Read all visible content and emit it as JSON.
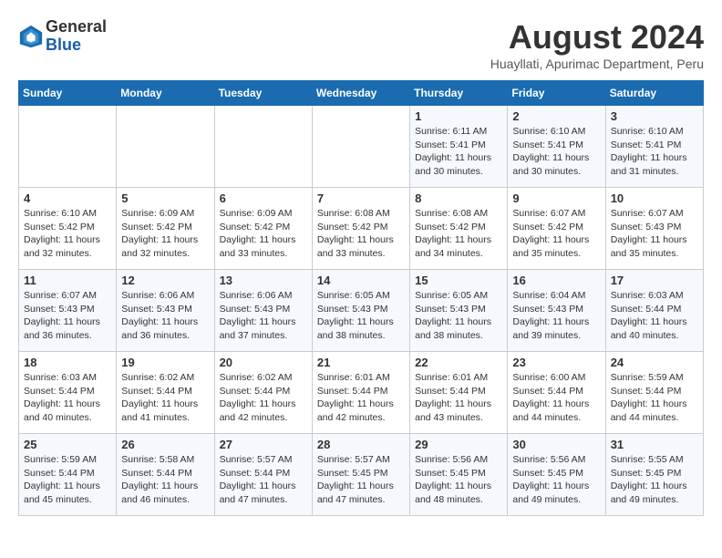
{
  "header": {
    "logo_line1": "General",
    "logo_line2": "Blue",
    "month_title": "August 2024",
    "location": "Huayllati, Apurimac Department, Peru"
  },
  "days_of_week": [
    "Sunday",
    "Monday",
    "Tuesday",
    "Wednesday",
    "Thursday",
    "Friday",
    "Saturday"
  ],
  "weeks": [
    [
      {
        "day": "",
        "info": ""
      },
      {
        "day": "",
        "info": ""
      },
      {
        "day": "",
        "info": ""
      },
      {
        "day": "",
        "info": ""
      },
      {
        "day": "1",
        "info": "Sunrise: 6:11 AM\nSunset: 5:41 PM\nDaylight: 11 hours\nand 30 minutes."
      },
      {
        "day": "2",
        "info": "Sunrise: 6:10 AM\nSunset: 5:41 PM\nDaylight: 11 hours\nand 30 minutes."
      },
      {
        "day": "3",
        "info": "Sunrise: 6:10 AM\nSunset: 5:41 PM\nDaylight: 11 hours\nand 31 minutes."
      }
    ],
    [
      {
        "day": "4",
        "info": "Sunrise: 6:10 AM\nSunset: 5:42 PM\nDaylight: 11 hours\nand 32 minutes."
      },
      {
        "day": "5",
        "info": "Sunrise: 6:09 AM\nSunset: 5:42 PM\nDaylight: 11 hours\nand 32 minutes."
      },
      {
        "day": "6",
        "info": "Sunrise: 6:09 AM\nSunset: 5:42 PM\nDaylight: 11 hours\nand 33 minutes."
      },
      {
        "day": "7",
        "info": "Sunrise: 6:08 AM\nSunset: 5:42 PM\nDaylight: 11 hours\nand 33 minutes."
      },
      {
        "day": "8",
        "info": "Sunrise: 6:08 AM\nSunset: 5:42 PM\nDaylight: 11 hours\nand 34 minutes."
      },
      {
        "day": "9",
        "info": "Sunrise: 6:07 AM\nSunset: 5:42 PM\nDaylight: 11 hours\nand 35 minutes."
      },
      {
        "day": "10",
        "info": "Sunrise: 6:07 AM\nSunset: 5:43 PM\nDaylight: 11 hours\nand 35 minutes."
      }
    ],
    [
      {
        "day": "11",
        "info": "Sunrise: 6:07 AM\nSunset: 5:43 PM\nDaylight: 11 hours\nand 36 minutes."
      },
      {
        "day": "12",
        "info": "Sunrise: 6:06 AM\nSunset: 5:43 PM\nDaylight: 11 hours\nand 36 minutes."
      },
      {
        "day": "13",
        "info": "Sunrise: 6:06 AM\nSunset: 5:43 PM\nDaylight: 11 hours\nand 37 minutes."
      },
      {
        "day": "14",
        "info": "Sunrise: 6:05 AM\nSunset: 5:43 PM\nDaylight: 11 hours\nand 38 minutes."
      },
      {
        "day": "15",
        "info": "Sunrise: 6:05 AM\nSunset: 5:43 PM\nDaylight: 11 hours\nand 38 minutes."
      },
      {
        "day": "16",
        "info": "Sunrise: 6:04 AM\nSunset: 5:43 PM\nDaylight: 11 hours\nand 39 minutes."
      },
      {
        "day": "17",
        "info": "Sunrise: 6:03 AM\nSunset: 5:44 PM\nDaylight: 11 hours\nand 40 minutes."
      }
    ],
    [
      {
        "day": "18",
        "info": "Sunrise: 6:03 AM\nSunset: 5:44 PM\nDaylight: 11 hours\nand 40 minutes."
      },
      {
        "day": "19",
        "info": "Sunrise: 6:02 AM\nSunset: 5:44 PM\nDaylight: 11 hours\nand 41 minutes."
      },
      {
        "day": "20",
        "info": "Sunrise: 6:02 AM\nSunset: 5:44 PM\nDaylight: 11 hours\nand 42 minutes."
      },
      {
        "day": "21",
        "info": "Sunrise: 6:01 AM\nSunset: 5:44 PM\nDaylight: 11 hours\nand 42 minutes."
      },
      {
        "day": "22",
        "info": "Sunrise: 6:01 AM\nSunset: 5:44 PM\nDaylight: 11 hours\nand 43 minutes."
      },
      {
        "day": "23",
        "info": "Sunrise: 6:00 AM\nSunset: 5:44 PM\nDaylight: 11 hours\nand 44 minutes."
      },
      {
        "day": "24",
        "info": "Sunrise: 5:59 AM\nSunset: 5:44 PM\nDaylight: 11 hours\nand 44 minutes."
      }
    ],
    [
      {
        "day": "25",
        "info": "Sunrise: 5:59 AM\nSunset: 5:44 PM\nDaylight: 11 hours\nand 45 minutes."
      },
      {
        "day": "26",
        "info": "Sunrise: 5:58 AM\nSunset: 5:44 PM\nDaylight: 11 hours\nand 46 minutes."
      },
      {
        "day": "27",
        "info": "Sunrise: 5:57 AM\nSunset: 5:44 PM\nDaylight: 11 hours\nand 47 minutes."
      },
      {
        "day": "28",
        "info": "Sunrise: 5:57 AM\nSunset: 5:45 PM\nDaylight: 11 hours\nand 47 minutes."
      },
      {
        "day": "29",
        "info": "Sunrise: 5:56 AM\nSunset: 5:45 PM\nDaylight: 11 hours\nand 48 minutes."
      },
      {
        "day": "30",
        "info": "Sunrise: 5:56 AM\nSunset: 5:45 PM\nDaylight: 11 hours\nand 49 minutes."
      },
      {
        "day": "31",
        "info": "Sunrise: 5:55 AM\nSunset: 5:45 PM\nDaylight: 11 hours\nand 49 minutes."
      }
    ]
  ]
}
